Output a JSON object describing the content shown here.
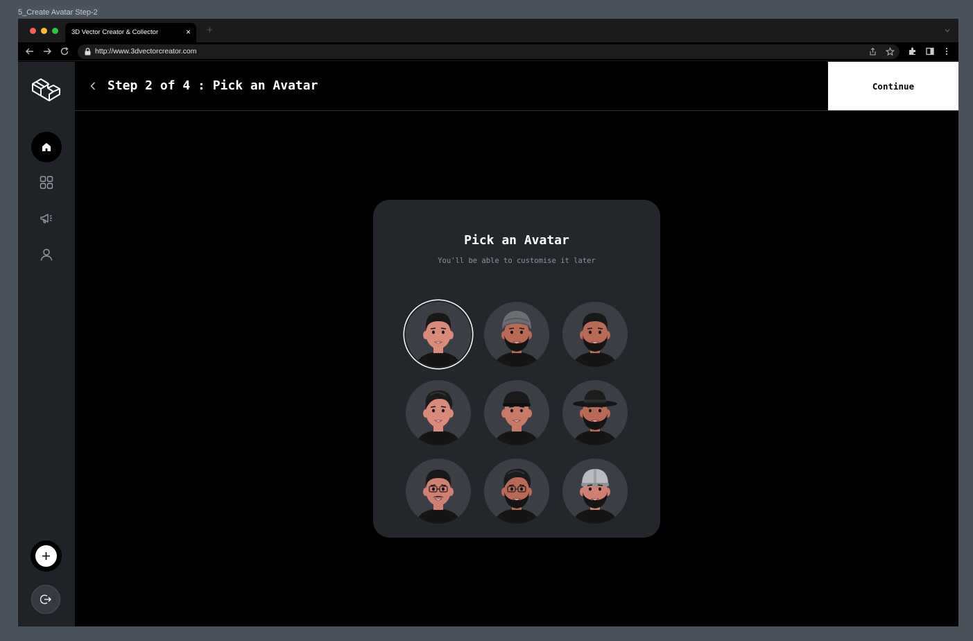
{
  "frame_label": "5_Create Avatar Step-2",
  "browser": {
    "tab_title": "3D Vector Creator & Collector",
    "tab_close": "×",
    "new_tab": "+",
    "url": "http://www.3dvectorcreator.com"
  },
  "header": {
    "title": "Step 2 of 4 : Pick an Avatar",
    "continue_label": "Continue"
  },
  "card": {
    "title": "Pick an Avatar",
    "subtitle": "You'll be able to customise it later"
  },
  "avatars": [
    {
      "selected": true,
      "hair": "short-dark",
      "skin": "#d98a78",
      "beard": false
    },
    {
      "selected": false,
      "hair": "turban",
      "skin": "#b86a55",
      "beard": true
    },
    {
      "selected": false,
      "hair": "short-dark",
      "skin": "#b86a55",
      "beard": true
    },
    {
      "selected": false,
      "hair": "wavy-dark",
      "skin": "#d98a78",
      "beard": false
    },
    {
      "selected": false,
      "hair": "cap",
      "skin": "#c77a66",
      "beard": false
    },
    {
      "selected": false,
      "hair": "hat",
      "skin": "#b86a55",
      "beard": true
    },
    {
      "selected": false,
      "hair": "short-dark",
      "skin": "#d08070",
      "beard": false,
      "glasses": true,
      "mustache": true
    },
    {
      "selected": false,
      "hair": "wavy-dark",
      "skin": "#b86a55",
      "beard": true,
      "glasses": true
    },
    {
      "selected": false,
      "hair": "helmet",
      "skin": "#d08070",
      "beard": true
    }
  ],
  "colors": {
    "sidebar": "#1f2227",
    "card": "#23272c",
    "avatar_bg": "#3b3f45",
    "accent": "#ffffff"
  },
  "icons": {
    "logo": "3d-box-logo-icon",
    "home": "home-icon",
    "grid": "grid-icon",
    "megaphone": "megaphone-icon",
    "profile": "user-icon",
    "add": "plus-icon",
    "logout": "logout-icon"
  }
}
